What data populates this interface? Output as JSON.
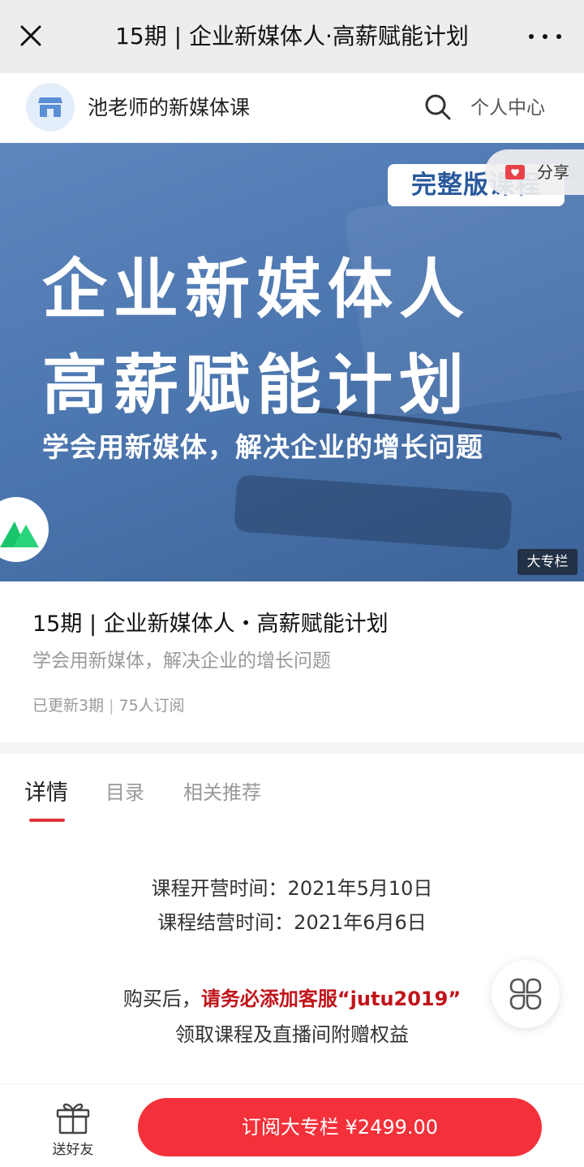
{
  "topbar": {
    "title": "15期 | 企业新媒体人·高薪赋能计划"
  },
  "shop": {
    "name": "池老师的新媒体课",
    "personal_center": "个人中心"
  },
  "banner": {
    "badge": "完整版课程",
    "main_line1": "企业新媒体人",
    "main_line2": "高薪赋能计划",
    "subtitle": "学会用新媒体，解决企业的增长问题",
    "tag": "大专栏",
    "share_label": "分享"
  },
  "course": {
    "title": "15期 | 企业新媒体人・高薪赋能计划",
    "subtitle": "学会用新媒体，解决企业的增长问题",
    "updated": "已更新3期",
    "subscribers": "75人订阅"
  },
  "tabs": [
    {
      "label": "详情",
      "active": true
    },
    {
      "label": "目录",
      "active": false
    },
    {
      "label": "相关推荐",
      "active": false
    }
  ],
  "details": {
    "open_time": "课程开营时间：2021年5月10日",
    "close_time": "课程结营时间：2021年6月6日",
    "notice_prefix": "购买后，",
    "notice_highlight": "请务必添加客服“jutu2019”",
    "notice_suffix": "领取课程及直播间附赠权益"
  },
  "bottom": {
    "gift_label": "送好友",
    "subscribe_label": "订阅大专栏 ¥2499.00"
  },
  "colors": {
    "accent_red": "#f4313a",
    "highlight_red": "#c0141a",
    "banner_blue": "#4d77b0"
  }
}
